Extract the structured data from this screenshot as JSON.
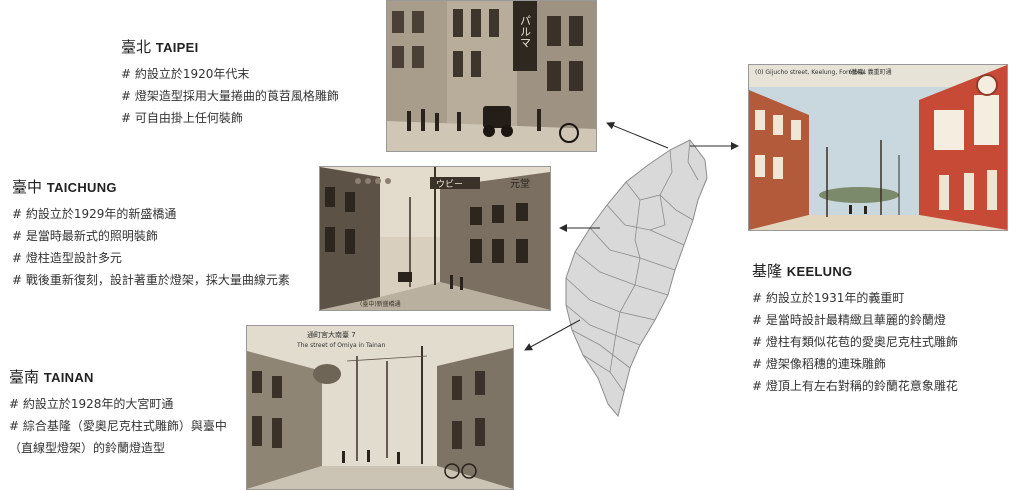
{
  "cities": {
    "taipei": {
      "name_zh": "臺北",
      "name_en": "TAIPEI",
      "bullets": [
        "# 約設立於1920年代末",
        "# 燈架造型採用大量捲曲的莨苕風格雕飾",
        "# 可自由掛上任何裝飾"
      ],
      "photo_sign": "パルマ"
    },
    "taichung": {
      "name_zh": "臺中",
      "name_en": "TAICHUNG",
      "bullets": [
        "# 約設立於1929年的新盛橋通",
        "# 是當時最新式的照明裝飾",
        "# 燈柱造型設計多元",
        "# 戰後重新復刻，設計著重於燈架，採大量曲線元素"
      ],
      "photo_sign": "ウビー",
      "photo_sign2": "元堂",
      "photo_caption": "(臺中)新盛橋通"
    },
    "tainan": {
      "name_zh": "臺南",
      "name_en": "TAINAN",
      "bullets": [
        "# 約設立於1928年的大宮町通",
        "# 綜合基隆（愛奧尼克柱式雕飾）與臺中",
        "（直線型燈架）的鈴蘭燈造型"
      ],
      "photo_caption_zh": "通町宮大南臺 7",
      "photo_caption_en": "The street of Omiya in Tainan"
    },
    "keelung": {
      "name_zh": "基隆",
      "name_en": "KEELUNG",
      "bullets": [
        "# 約設立於1931年的義重町",
        "# 是當時設計最精緻且華麗的鈴蘭燈",
        "# 燈柱有類似花苞的愛奧尼克柱式雕飾",
        "# 燈架像稻穗的連珠雕飾",
        "# 燈頂上有左右對稱的鈴蘭花意象雕花"
      ],
      "photo_caption_en": "(0) Gijucho street, Keelung, Formosa.",
      "photo_caption_zh": "(基隆) 義重町通"
    }
  },
  "colors": {
    "map_fill": "#d9d9d9",
    "map_stroke": "#8c8c8c",
    "arrow": "#2b2b2b",
    "sepia_dark": "#3a3128",
    "sepia_light": "#cfc6b6"
  }
}
